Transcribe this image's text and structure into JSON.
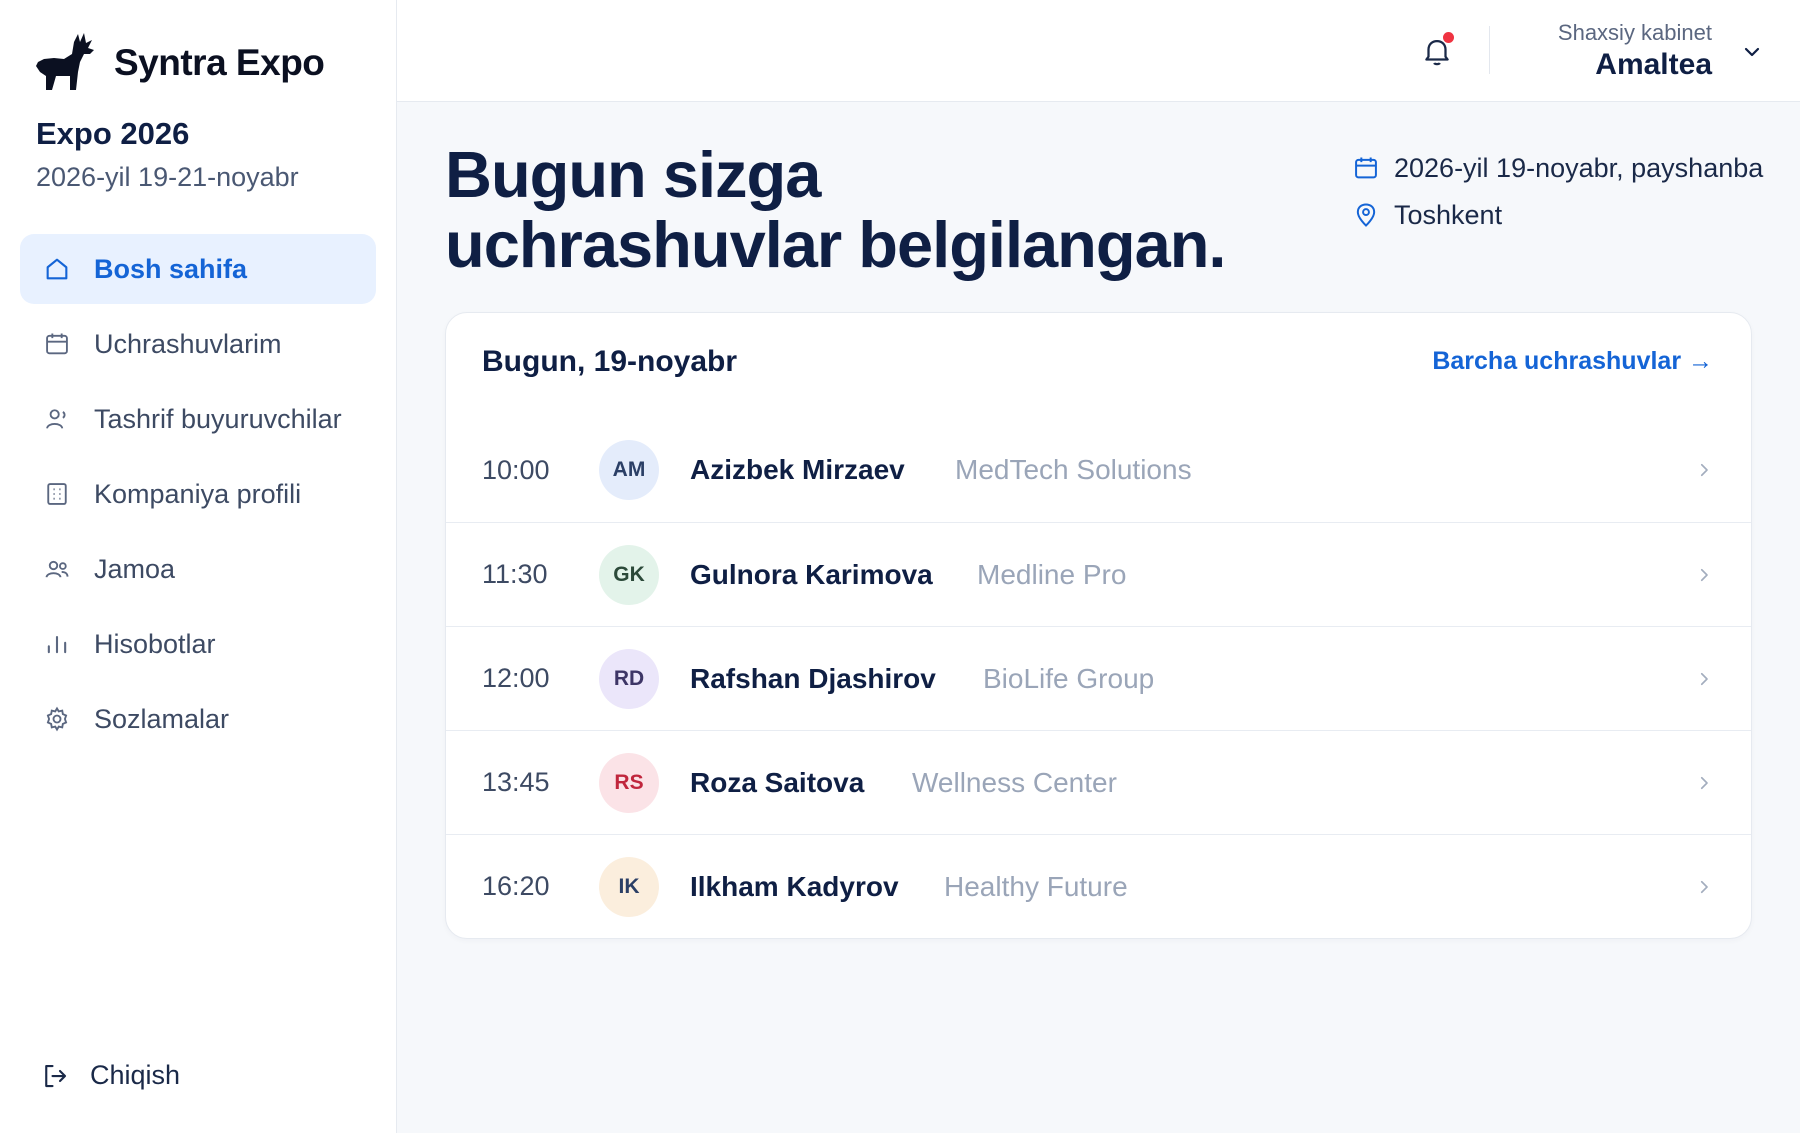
{
  "brand": {
    "name": "Syntra Expo"
  },
  "event": {
    "title": "Expo 2026",
    "dates": "2026-yil 19-21-noyabr"
  },
  "sidebar": {
    "items": [
      {
        "label": "Bosh sahifa",
        "icon": "home-icon",
        "active": true
      },
      {
        "label": "Uchrashuvlarim",
        "icon": "calendar-icon"
      },
      {
        "label": "Tashrif buyuruvchilar",
        "icon": "user-icon"
      },
      {
        "label": "Kompaniya profili",
        "icon": "building-icon"
      },
      {
        "label": "Jamoa",
        "icon": "users-icon"
      },
      {
        "label": "Hisobotlar",
        "icon": "bar-chart-icon"
      },
      {
        "label": "Sozlamalar",
        "icon": "gear-icon"
      }
    ],
    "logout": "Chiqish"
  },
  "topbar": {
    "account_label": "Shaxsiy kabinet",
    "account_name": "Amaltea",
    "has_notification": true
  },
  "main": {
    "headline_line1": "Bugun sizga",
    "headline_line2": "uchrashuvlar belgilangan.",
    "date": "2026-yil 19-noyabr, payshanba",
    "location": "Toshkent"
  },
  "meetings_card": {
    "title": "Bugun, 19-noyabr",
    "link": "Barcha uchrashuvlar →",
    "rows": [
      {
        "time": "10:00",
        "initials": "AM",
        "name": "Azizbek Mirzaev",
        "company": "MedTech Solutions",
        "avatar_bg": "#e4ecfb",
        "avatar_fg": "#2b3f66"
      },
      {
        "time": "11:30",
        "initials": "GK",
        "name": "Gulnora Karimova",
        "company": "Medline Pro",
        "avatar_bg": "#e3f3ea",
        "avatar_fg": "#2c4a3a"
      },
      {
        "time": "12:00",
        "initials": "RD",
        "name": "Rafshan Djashirov",
        "company": "BioLife Group",
        "avatar_bg": "#ebe6fa",
        "avatar_fg": "#3d3566"
      },
      {
        "time": "13:45",
        "initials": "RS",
        "name": "Roza Saitova",
        "company": "Wellness Center",
        "avatar_bg": "#fbe3e7",
        "avatar_fg": "#c0263d"
      },
      {
        "time": "16:20",
        "initials": "IK",
        "name": "Ilkham Kadyrov",
        "company": "Healthy Future",
        "avatar_bg": "#fbeedd",
        "avatar_fg": "#2b3f66"
      }
    ]
  },
  "colors": {
    "accent": "#1464d6",
    "text": "#0f1f44",
    "notification": "#ef3341"
  }
}
